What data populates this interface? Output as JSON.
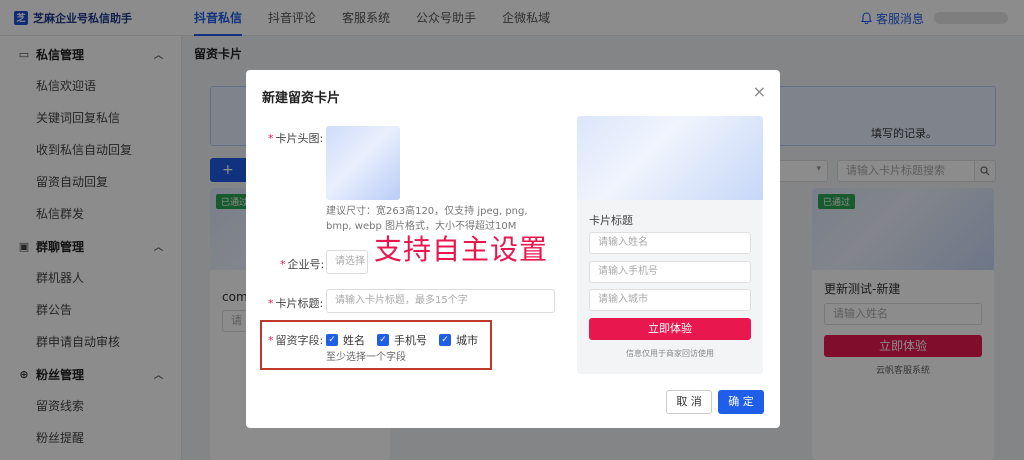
{
  "app": {
    "name": "芝麻企业号私信助手",
    "logo_mark": "芝"
  },
  "topnav": [
    {
      "label": "抖音私信",
      "active": true
    },
    {
      "label": "抖音评论",
      "active": false
    },
    {
      "label": "客服系统",
      "active": false
    },
    {
      "label": "公众号助手",
      "active": false
    },
    {
      "label": "企微私域",
      "active": false
    }
  ],
  "topright": {
    "support_label": "客服消息",
    "support_icon": "bell-icon"
  },
  "sidebar": {
    "groups": [
      {
        "title": "私信管理",
        "icon": "message-icon",
        "items": [
          "私信欢迎语",
          "关键词回复私信",
          "收到私信自动回复",
          "留资自动回复",
          "私信群发"
        ]
      },
      {
        "title": "群聊管理",
        "icon": "group-chat-icon",
        "items": [
          "群机器人",
          "群公告",
          "群申请自动审核"
        ]
      },
      {
        "title": "粉丝管理",
        "icon": "fans-icon",
        "items": [
          "留资线索",
          "粉丝提醒"
        ]
      }
    ]
  },
  "page": {
    "title": "留资卡片",
    "info_tail": "填写的记录。",
    "create_label": "+",
    "search_placeholder": "请输入卡片标题搜索"
  },
  "cards": [
    {
      "badge": "已通过",
      "title": "comm",
      "input_placeholder": "请"
    },
    {
      "badge": "已通过",
      "title": "更新测试-新建",
      "input_placeholder": "请输入姓名",
      "button": "立即体验",
      "footer": "云帆客服系统"
    }
  ],
  "modal": {
    "title": "新建留资卡片",
    "close_label": "×",
    "fields": {
      "image_label": "卡片头图:",
      "image_hint": "建议尺寸：宽263高120，仅支持 jpeg, png, bmp, webp 图片格式，大小不得超过10M",
      "account_label": "企业号:",
      "account_placeholder": "请选择",
      "title_label": "卡片标题:",
      "title_placeholder": "请输入卡片标题，最多15个字",
      "fields_label": "留资字段:",
      "options": [
        "姓名",
        "手机号",
        "城市"
      ],
      "fields_help": "至少选择一个字段"
    },
    "overlay_text": "支持自主设置",
    "preview": {
      "title": "卡片标题",
      "inputs": [
        "请输入姓名",
        "请输入手机号",
        "请输入城市"
      ],
      "button": "立即体验",
      "note": "信息仅用于商家回访使用"
    },
    "cancel_label": "取 消",
    "ok_label": "确 定"
  },
  "colors": {
    "primary": "#1f5ee8",
    "accent": "#e8184f",
    "success": "#2aa552"
  }
}
